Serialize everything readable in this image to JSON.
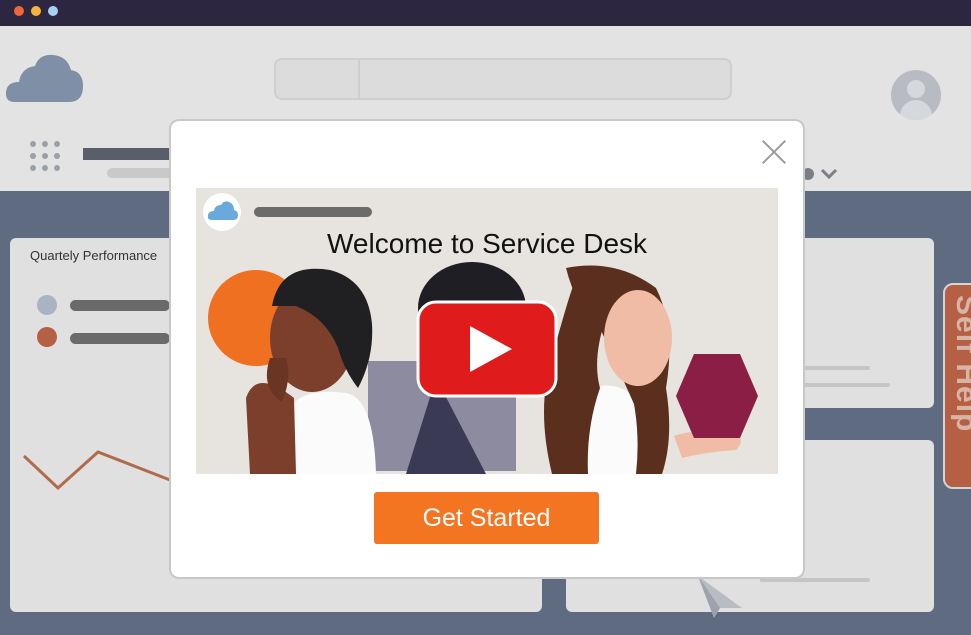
{
  "window": {
    "controls": [
      {
        "name": "close",
        "color": "#f0653a"
      },
      {
        "name": "minimize",
        "color": "#f5b33d"
      },
      {
        "name": "maximize",
        "color": "#a8cff2"
      }
    ]
  },
  "app": {
    "logo_icon": "cloud-icon",
    "avatar_icon": "user-avatar-icon",
    "apps_icon": "apps-grid-icon"
  },
  "dashboard": {
    "card_title": "Quartely Performance",
    "legend_colors": [
      "#a9b3c4",
      "#b55f45"
    ],
    "self_help_label": "Self Help"
  },
  "modal": {
    "title": "Welcome to Service Desk",
    "cta_label": "Get Started",
    "close_icon": "close-icon",
    "play_icon": "play-icon",
    "accent": "#f47521",
    "play_color": "#e01b1b"
  }
}
